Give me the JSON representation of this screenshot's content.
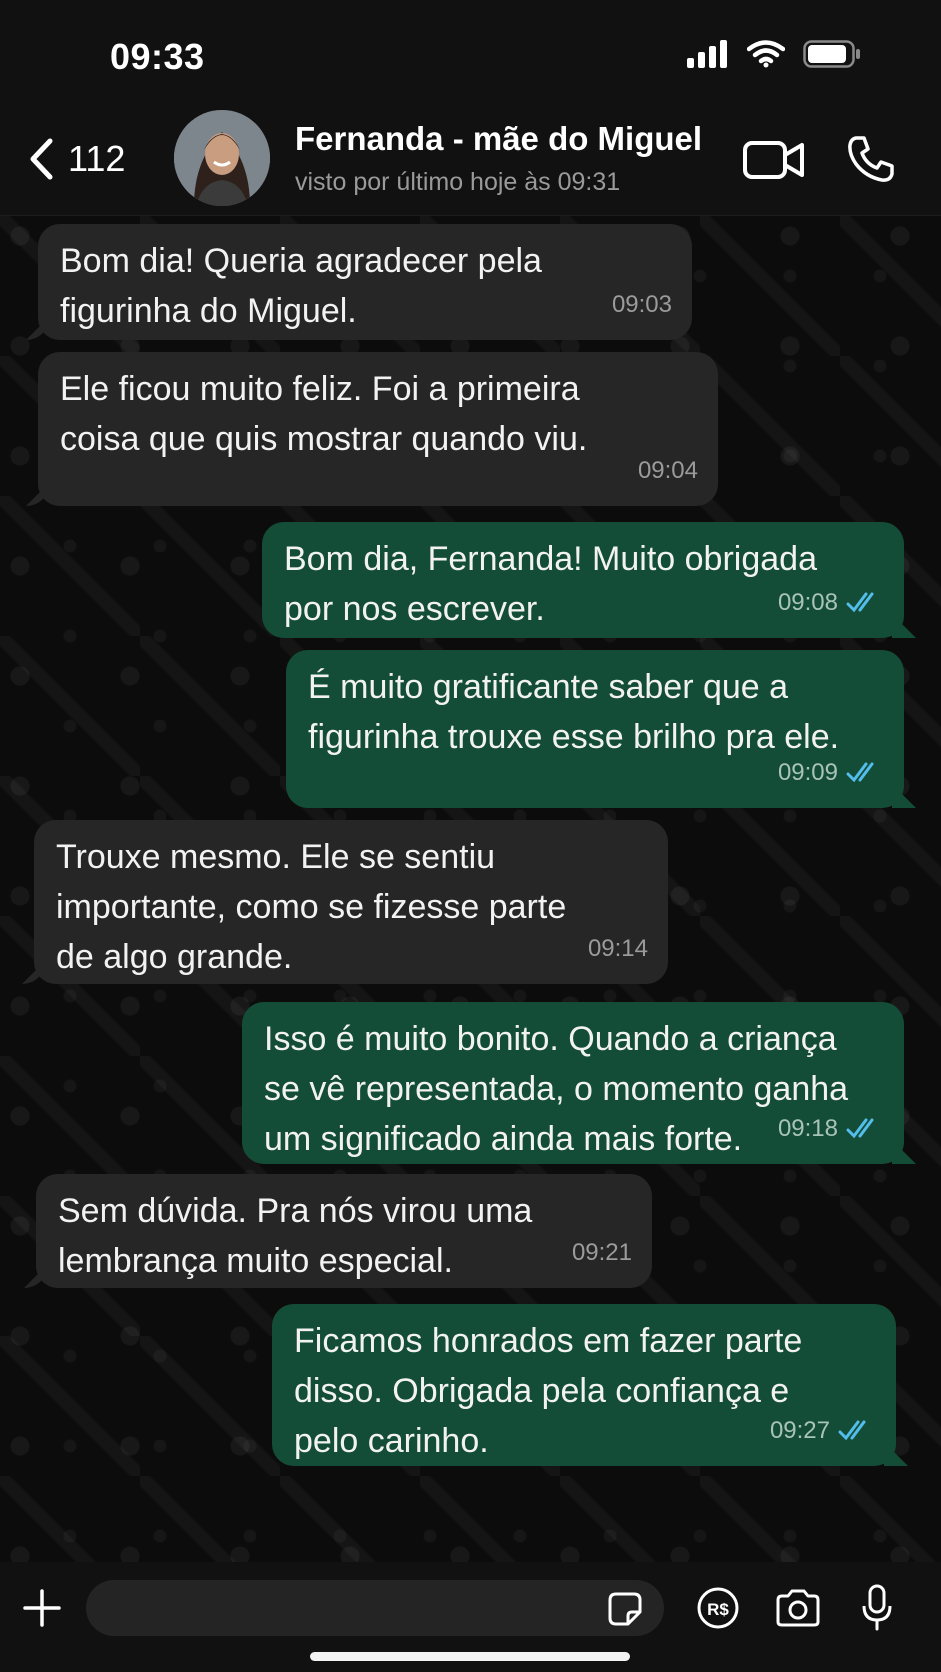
{
  "status_bar": {
    "time": "09:33"
  },
  "header": {
    "back_count": "112",
    "contact_name": "Fernanda - mãe do Miguel",
    "contact_status": "visto por último hoje às 09:31"
  },
  "messages": [
    {
      "direction": "incoming",
      "text": "Bom dia! Queria agradecer pela\nfigurinha do Miguel.",
      "time": "09:03"
    },
    {
      "direction": "incoming",
      "text": "Ele ficou muito feliz. Foi a primeira\ncoisa que quis mostrar quando viu.",
      "time": "09:04"
    },
    {
      "direction": "outgoing",
      "text": "Bom dia, Fernanda! Muito obrigada\npor nos escrever.",
      "time": "09:08",
      "read": true
    },
    {
      "direction": "outgoing",
      "text": "É muito gratificante saber que a\nfigurinha trouxe esse brilho pra ele.",
      "time": "09:09",
      "read": true
    },
    {
      "direction": "incoming",
      "text": "Trouxe mesmo. Ele se sentiu\nimportante, como se fizesse parte\nde algo grande.",
      "time": "09:14"
    },
    {
      "direction": "outgoing",
      "text": "Isso é muito bonito. Quando a criança\nse vê representada, o momento ganha\num significado ainda mais forte.",
      "time": "09:18",
      "read": true
    },
    {
      "direction": "incoming",
      "text": "Sem dúvida. Pra nós virou uma\nlembrança muito especial.",
      "time": "09:21"
    },
    {
      "direction": "outgoing",
      "text": "Ficamos honrados em fazer parte\ndisso. Obrigada pela confiança e\npelo carinho.",
      "time": "09:27",
      "read": true
    }
  ],
  "input_bar": {
    "placeholder": "",
    "pay_label": "R$"
  },
  "colors": {
    "incoming_bubble": "#262626",
    "outgoing_bubble": "#144d37",
    "read_ticks": "#53bdeb",
    "background": "#0c0c0c"
  },
  "icons": [
    "back-chevron-icon",
    "video-call-icon",
    "phone-icon",
    "plus-icon",
    "sticker-icon",
    "payment-icon",
    "camera-icon",
    "microphone-icon",
    "double-check-icon",
    "signal-icon",
    "wifi-icon",
    "battery-icon"
  ]
}
